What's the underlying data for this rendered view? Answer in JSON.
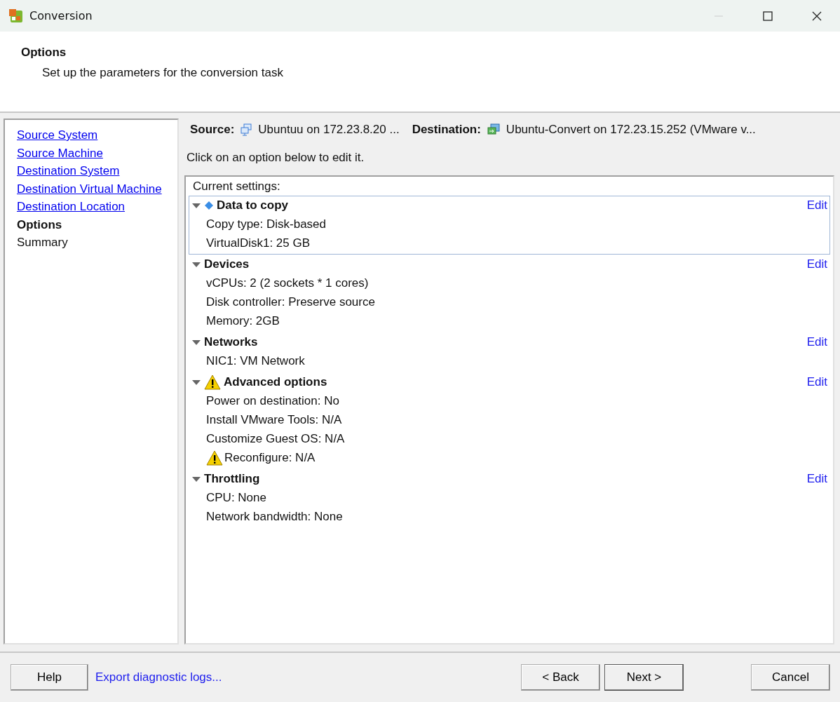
{
  "window": {
    "title": "Conversion"
  },
  "header": {
    "title": "Options",
    "subtitle": "Set up the parameters for the conversion task"
  },
  "sidebar": {
    "items": [
      {
        "label": "Source System",
        "kind": "link"
      },
      {
        "label": "Source Machine",
        "kind": "link"
      },
      {
        "label": "Destination System",
        "kind": "link"
      },
      {
        "label": "Destination Virtual Machine",
        "kind": "link"
      },
      {
        "label": "Destination Location",
        "kind": "link"
      },
      {
        "label": "Options",
        "kind": "current"
      },
      {
        "label": "Summary",
        "kind": "pending"
      }
    ]
  },
  "summary": {
    "source_label": "Source:",
    "source": "Ubuntuu on 172.23.8.20 ...",
    "destination_label": "Destination:",
    "destination": "Ubuntu-Convert on 172.23.15.252 (VMware v..."
  },
  "instruction": "Click on an option below to edit it.",
  "settings": {
    "caption": "Current settings:",
    "sections": [
      {
        "title": "Data to copy",
        "kind": "data",
        "expanded": true,
        "selected": true,
        "edit": "Edit",
        "items": [
          {
            "text": "Copy type: Disk-based",
            "warning": false
          },
          {
            "text": "VirtualDisk1: 25 GB",
            "warning": false
          }
        ]
      },
      {
        "title": "Devices",
        "kind": "plain",
        "expanded": true,
        "selected": false,
        "edit": "Edit",
        "items": [
          {
            "text": "vCPUs: 2 (2 sockets * 1 cores)",
            "warning": false
          },
          {
            "text": "Disk controller: Preserve source",
            "warning": false
          },
          {
            "text": "Memory: 2GB",
            "warning": false
          }
        ]
      },
      {
        "title": "Networks",
        "kind": "plain",
        "expanded": true,
        "selected": false,
        "edit": "Edit",
        "items": [
          {
            "text": "NIC1: VM Network",
            "warning": false
          }
        ]
      },
      {
        "title": "Advanced options",
        "kind": "warning",
        "expanded": true,
        "selected": false,
        "edit": "Edit",
        "items": [
          {
            "text": "Power on destination: No",
            "warning": false
          },
          {
            "text": "Install VMware Tools: N/A",
            "warning": false
          },
          {
            "text": "Customize Guest OS: N/A",
            "warning": false
          },
          {
            "text": "Reconfigure: N/A",
            "warning": true
          }
        ]
      },
      {
        "title": "Throttling",
        "kind": "plain",
        "expanded": true,
        "selected": false,
        "edit": "Edit",
        "items": [
          {
            "text": "CPU: None",
            "warning": false
          },
          {
            "text": "Network bandwidth: None",
            "warning": false
          }
        ]
      }
    ]
  },
  "footer": {
    "help": "Help",
    "export_link": "Export diagnostic logs...",
    "back": "< Back",
    "next": "Next >",
    "cancel": "Cancel"
  }
}
